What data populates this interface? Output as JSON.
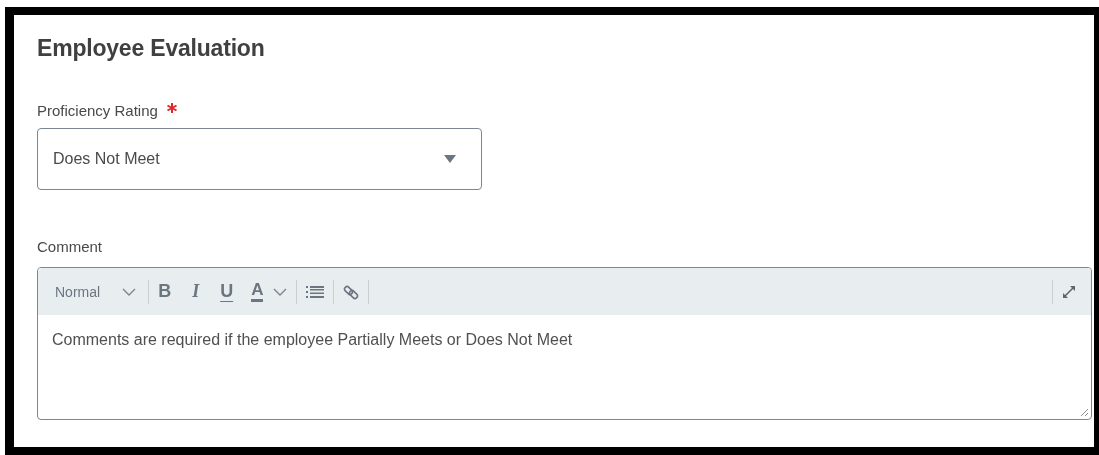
{
  "section": {
    "title": "Employee Evaluation"
  },
  "proficiency_rating": {
    "label": "Proficiency Rating",
    "required": true,
    "value": "Does Not Meet"
  },
  "comment": {
    "label": "Comment",
    "required": false,
    "toolbar": [
      {
        "kind": "dropdown",
        "label": "Normal"
      },
      {
        "kind": "bold",
        "label": "B"
      },
      {
        "kind": "italic",
        "label": "I"
      },
      {
        "kind": "underline",
        "label": "U"
      },
      {
        "kind": "color",
        "label": "A"
      },
      {
        "kind": "list"
      },
      {
        "kind": "link"
      }
    ],
    "value": "Comments are required if the employee Partially Meets or Does Not Meet"
  }
}
